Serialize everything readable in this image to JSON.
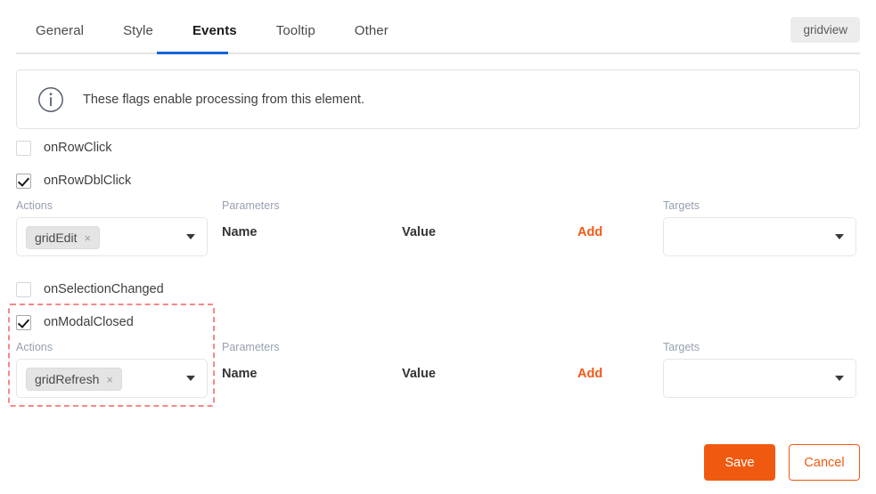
{
  "header": {
    "tabs": [
      {
        "label": "General",
        "active": false
      },
      {
        "label": "Style",
        "active": false
      },
      {
        "label": "Events",
        "active": true
      },
      {
        "label": "Tooltip",
        "active": false
      },
      {
        "label": "Other",
        "active": false
      }
    ],
    "badge": "gridview",
    "active_tab_color": "#1565d8"
  },
  "info": {
    "icon": "info-circle-icon",
    "message": "These flags enable processing from this element."
  },
  "labels": {
    "actions": "Actions",
    "parameters": "Parameters",
    "targets": "Targets",
    "name": "Name",
    "value": "Value",
    "add": "Add",
    "add_color": "#f25915"
  },
  "events": [
    {
      "name": "onRowClick",
      "checked": false,
      "expanded": false
    },
    {
      "name": "onRowDblClick",
      "checked": true,
      "expanded": true,
      "actions": [
        {
          "label": "gridEdit",
          "remove": "×"
        }
      ],
      "targets": []
    },
    {
      "name": "onSelectionChanged",
      "checked": false,
      "expanded": false
    },
    {
      "name": "onModalClosed",
      "checked": true,
      "expanded": true,
      "highlighted": true,
      "actions": [
        {
          "label": "gridRefresh",
          "remove": "×"
        }
      ],
      "targets": []
    }
  ],
  "highlight": {
    "color": "#f58989",
    "style": "dashed"
  },
  "footer": {
    "save": "Save",
    "cancel": "Cancel",
    "accent": "#f05a10"
  }
}
